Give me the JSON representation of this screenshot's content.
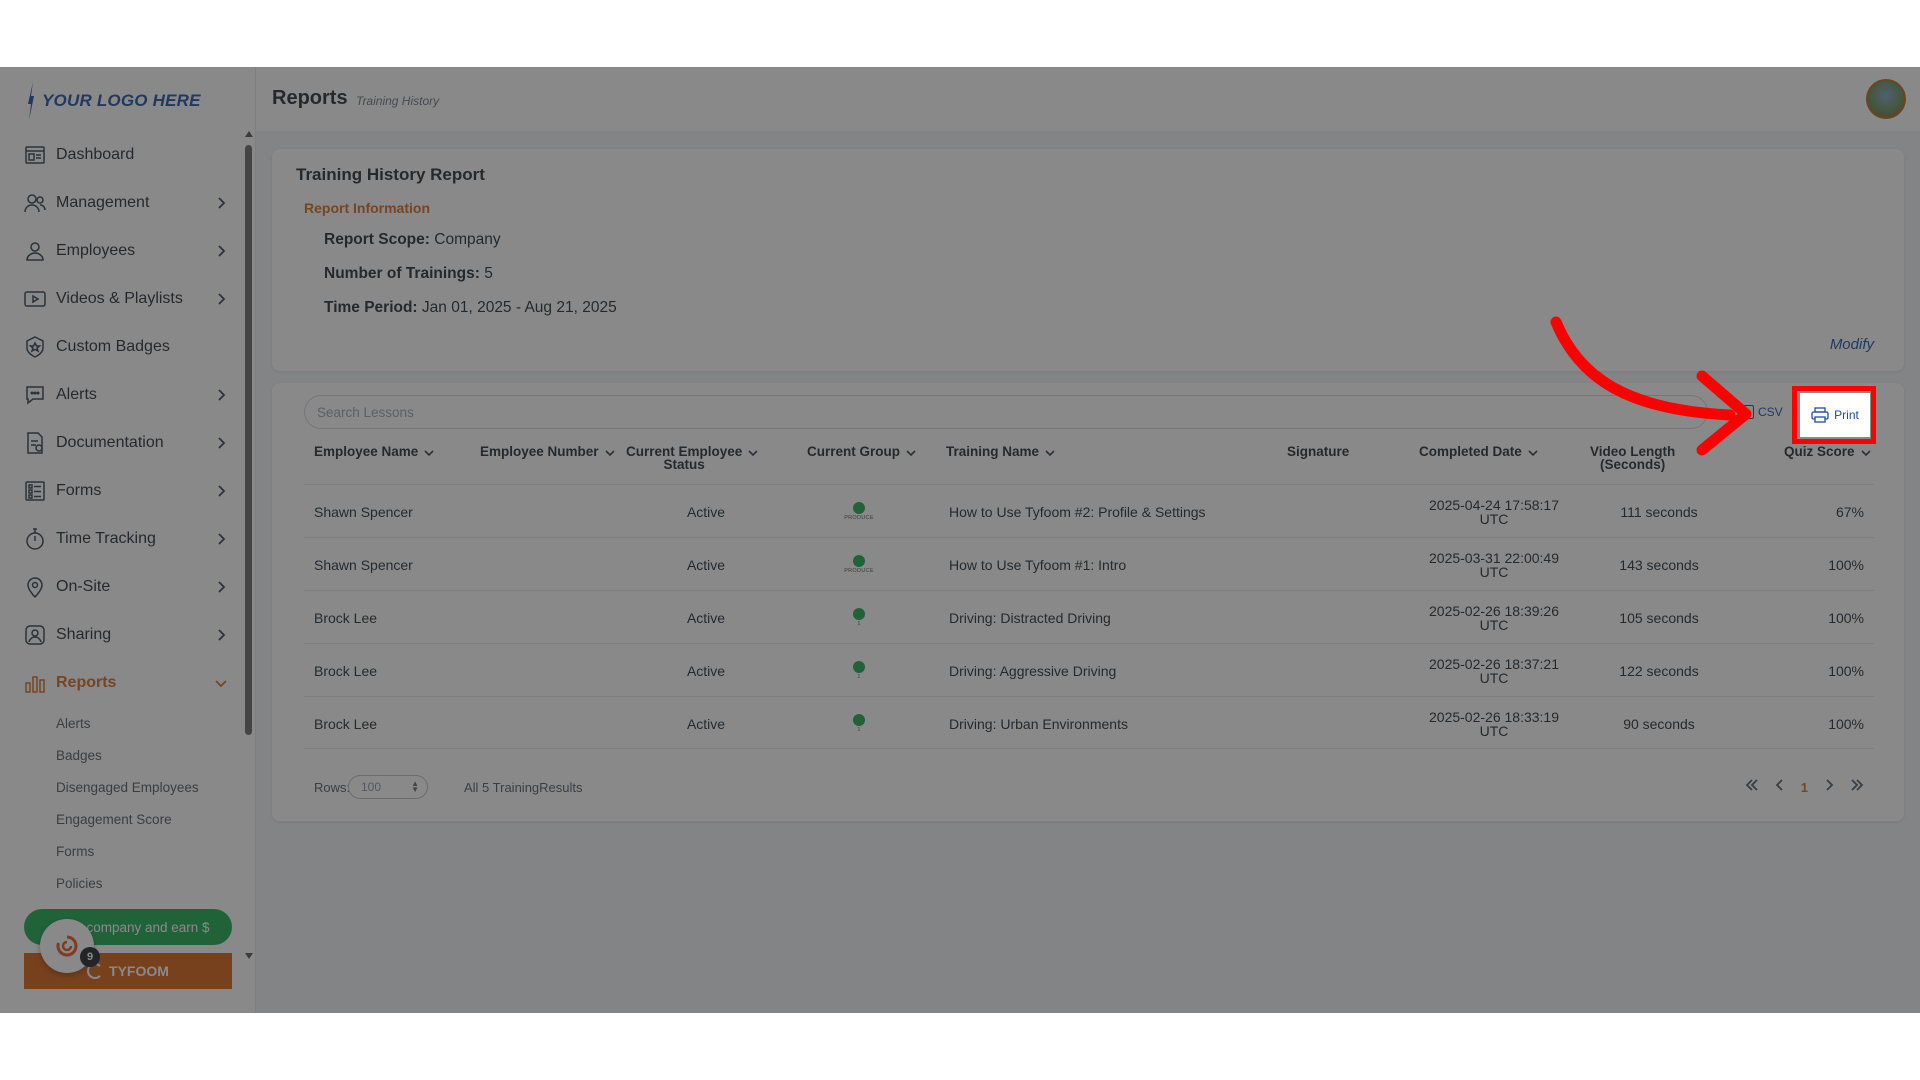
{
  "logo": {
    "text": "YOUR LOGO HERE"
  },
  "header": {
    "title": "Reports",
    "breadcrumb": "Training History"
  },
  "sidebar": {
    "items": [
      {
        "label": "Dashboard",
        "icon": "dashboard-icon",
        "chevron": false
      },
      {
        "label": "Management",
        "icon": "management-icon",
        "chevron": true
      },
      {
        "label": "Employees",
        "icon": "employees-icon",
        "chevron": true
      },
      {
        "label": "Videos & Playlists",
        "icon": "video-icon",
        "chevron": true
      },
      {
        "label": "Custom Badges",
        "icon": "badge-icon",
        "chevron": false
      },
      {
        "label": "Alerts",
        "icon": "alerts-icon",
        "chevron": true
      },
      {
        "label": "Documentation",
        "icon": "documentation-icon",
        "chevron": true
      },
      {
        "label": "Forms",
        "icon": "forms-icon",
        "chevron": true
      },
      {
        "label": "Time Tracking",
        "icon": "stopwatch-icon",
        "chevron": true
      },
      {
        "label": "On-Site",
        "icon": "location-pin-icon",
        "chevron": true
      },
      {
        "label": "Sharing",
        "icon": "sharing-icon",
        "chevron": true
      },
      {
        "label": "Reports",
        "icon": "reports-icon",
        "chevron": true,
        "active": true
      }
    ],
    "reports_sub": [
      "Alerts",
      "Badges",
      "Disengaged Employees",
      "Engagement Score",
      "Forms",
      "Policies"
    ],
    "refer_label": "company and earn $",
    "tyfoom_label": "TYFOOM",
    "chat_badge": "9"
  },
  "report": {
    "title": "Training History Report",
    "subtitle": "Report Information",
    "scope_label": "Report Scope:",
    "scope_value": "Company",
    "count_label": "Number of Trainings:",
    "count_value": "5",
    "period_label": "Time Period:",
    "period_value": "Jan 01, 2025 - Aug 21, 2025",
    "modify": "Modify"
  },
  "table": {
    "search_placeholder": "Search Lessons",
    "csv_label": "CSV",
    "print_label": "Print",
    "headers": {
      "employee_name": "Employee Name",
      "employee_number": "Employee Number",
      "status_1": "Current Employee",
      "status_2": "Status",
      "group": "Current Group",
      "training": "Training Name",
      "signature": "Signature",
      "completed": "Completed Date",
      "video_1": "Video Length",
      "video_2": "(Seconds)",
      "quiz": "Quiz Score"
    },
    "rows": [
      {
        "name": "Shawn Spencer",
        "status": "Active",
        "group": "PRODUCE",
        "training": "How to Use Tyfoom #2: Profile & Settings",
        "date": "2025-04-24 17:58:17",
        "tz": "UTC",
        "video": "111 seconds",
        "quiz": "67%"
      },
      {
        "name": "Shawn Spencer",
        "status": "Active",
        "group": "PRODUCE",
        "training": "How to Use Tyfoom #1: Intro",
        "date": "2025-03-31 22:00:49",
        "tz": "UTC",
        "video": "143 seconds",
        "quiz": "100%"
      },
      {
        "name": "Brock Lee",
        "status": "Active",
        "group": "1",
        "training": "Driving: Distracted Driving",
        "date": "2025-02-26 18:39:26",
        "tz": "UTC",
        "video": "105 seconds",
        "quiz": "100%"
      },
      {
        "name": "Brock Lee",
        "status": "Active",
        "group": "1",
        "training": "Driving: Aggressive Driving",
        "date": "2025-02-26 18:37:21",
        "tz": "UTC",
        "video": "122 seconds",
        "quiz": "100%"
      },
      {
        "name": "Brock Lee",
        "status": "Active",
        "group": "1",
        "training": "Driving: Urban Environments",
        "date": "2025-02-26 18:33:19",
        "tz": "UTC",
        "video": "90 seconds",
        "quiz": "100%"
      }
    ],
    "rows_label": "Rows:",
    "rows_value": "100",
    "results_text": "All 5 TrainingResults",
    "current_page": "1"
  },
  "colors": {
    "accent": "#d4691b",
    "link": "#1c4fa3",
    "status_dot": "#19a84a",
    "highlight": "#ff0000"
  }
}
